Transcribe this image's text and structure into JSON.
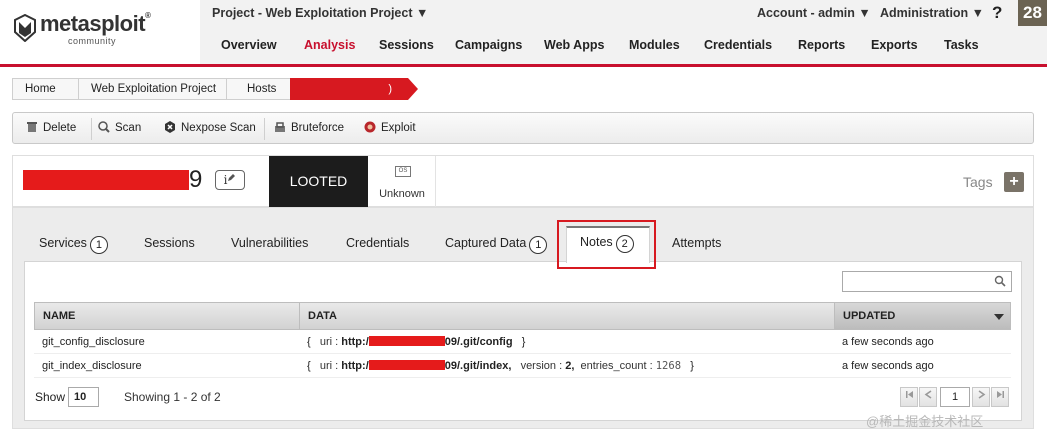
{
  "header": {
    "logo_text": "metasploit",
    "logo_registered": "®",
    "logo_sub": "community",
    "project_title": "Project - Web Exploitation Project ▼",
    "account_menu": "Account - admin ▼",
    "admin_menu": "Administration ▼",
    "help": "?",
    "badge": "28",
    "nav": [
      {
        "label": "Overview",
        "active": false
      },
      {
        "label": "Analysis",
        "active": true
      },
      {
        "label": "Sessions",
        "active": false
      },
      {
        "label": "Campaigns",
        "active": false
      },
      {
        "label": "Web Apps",
        "active": false
      },
      {
        "label": "Modules",
        "active": false
      },
      {
        "label": "Credentials",
        "active": false
      },
      {
        "label": "Reports",
        "active": false
      },
      {
        "label": "Exports",
        "active": false
      },
      {
        "label": "Tasks",
        "active": false
      }
    ],
    "accent_color": "#c8102e"
  },
  "breadcrumb": {
    "items": [
      "Home",
      "Web Exploitation Project",
      "Hosts"
    ],
    "current": ")"
  },
  "toolbar": {
    "delete": "Delete",
    "scan": "Scan",
    "nexpose_scan": "Nexpose Scan",
    "bruteforce": "Bruteforce",
    "exploit": "Exploit"
  },
  "host": {
    "ip_suffix": "9",
    "info_glyph": "i",
    "status": "LOOTED",
    "os_icon_text": "OS",
    "os": "Unknown",
    "tags_label": "Tags",
    "tags_add": "+"
  },
  "tabs": {
    "services": {
      "label": "Services",
      "count": "1"
    },
    "sessions": {
      "label": "Sessions"
    },
    "vulnerabilities": {
      "label": "Vulnerabilities"
    },
    "credentials": {
      "label": "Credentials"
    },
    "captured_data": {
      "label": "Captured Data",
      "count": "1"
    },
    "notes": {
      "label": "Notes",
      "count": "2"
    },
    "attempts": {
      "label": "Attempts"
    }
  },
  "notes_table": {
    "search_placeholder": "",
    "columns": {
      "name": "NAME",
      "data": "DATA",
      "updated": "UPDATED"
    },
    "rows": [
      {
        "name": "git_config_disclosure",
        "data_open": "{",
        "uri_key": "uri :",
        "uri_prefix": "http:/",
        "uri_suffix": "09/.git/config",
        "data_close": "}",
        "updated": "a few seconds ago"
      },
      {
        "name": "git_index_disclosure",
        "data_open": "{",
        "uri_key": "uri :",
        "uri_prefix": "http:/",
        "uri_suffix": "09/.git/index,",
        "version_key": "version :",
        "version_val": "2,",
        "entries_key": "entries_count :",
        "entries_val": "1268",
        "data_close": "}",
        "updated": "a few seconds ago"
      }
    ]
  },
  "footer": {
    "show_label": "Show",
    "show_value": "10",
    "showing": "Showing 1 - 2 of 2",
    "page": "1"
  },
  "watermark": "@稀土掘金技术社区"
}
